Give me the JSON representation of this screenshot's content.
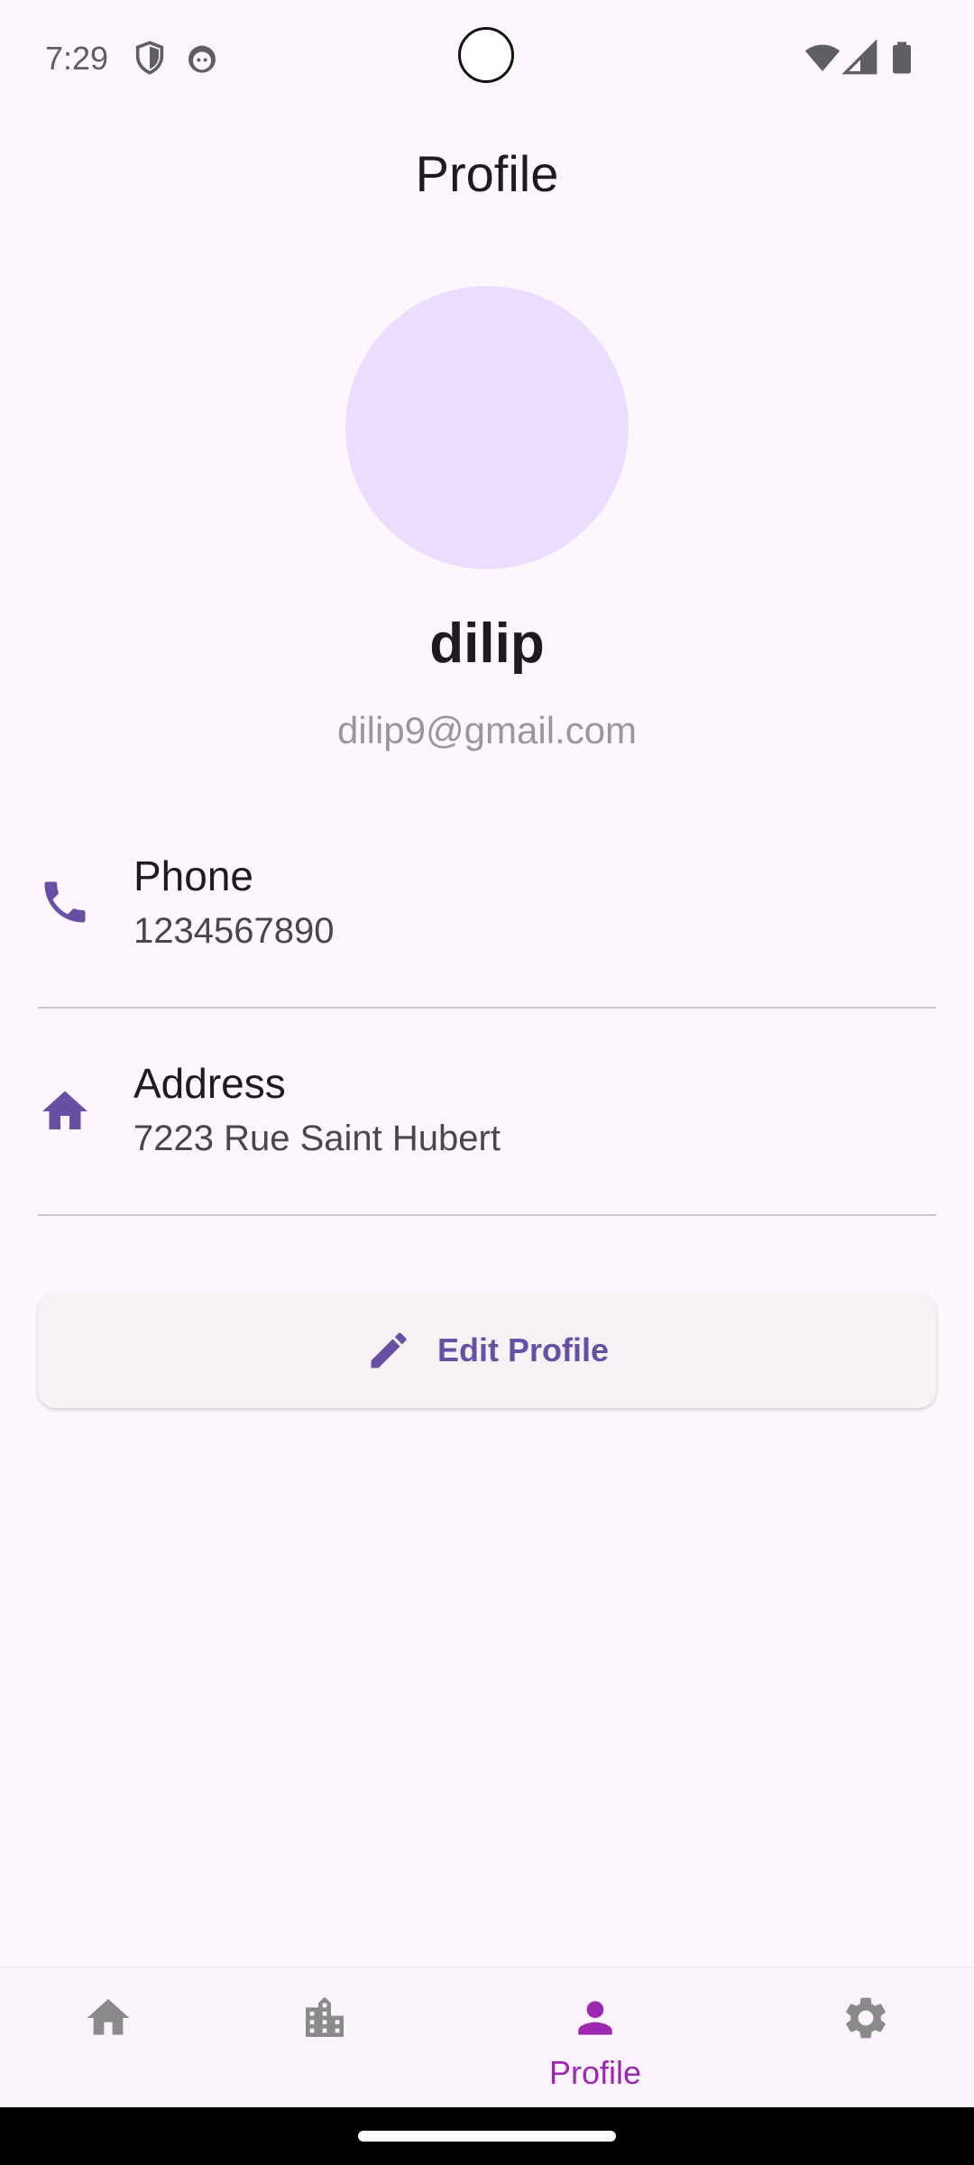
{
  "status_bar": {
    "time": "7:29",
    "left_icons": [
      "shield-icon",
      "face-icon"
    ],
    "right_icons": [
      "wifi-icon",
      "signal-icon",
      "battery-icon"
    ]
  },
  "header": {
    "title": "Profile"
  },
  "profile": {
    "name": "dilip",
    "email": "dilip9@gmail.com",
    "avatar_color": "#eaddfe"
  },
  "info": [
    {
      "icon": "phone-icon",
      "label": "Phone",
      "value": "1234567890"
    },
    {
      "icon": "home-icon",
      "label": "Address",
      "value": "7223 Rue Saint Hubert"
    }
  ],
  "actions": {
    "edit_label": "Edit Profile",
    "edit_icon": "pencil-icon"
  },
  "bottom_nav": {
    "items": [
      {
        "icon": "home-icon",
        "label": "",
        "selected": false
      },
      {
        "icon": "building-icon",
        "label": "",
        "selected": false
      },
      {
        "icon": "person-icon",
        "label": "Profile",
        "selected": true
      },
      {
        "icon": "settings-icon",
        "label": "",
        "selected": false
      }
    ]
  },
  "colors": {
    "accent": "#6750a4",
    "nav_selected": "#9c27b0",
    "nav_unselected": "#8a8a8a",
    "background": "#fdf7fd"
  }
}
